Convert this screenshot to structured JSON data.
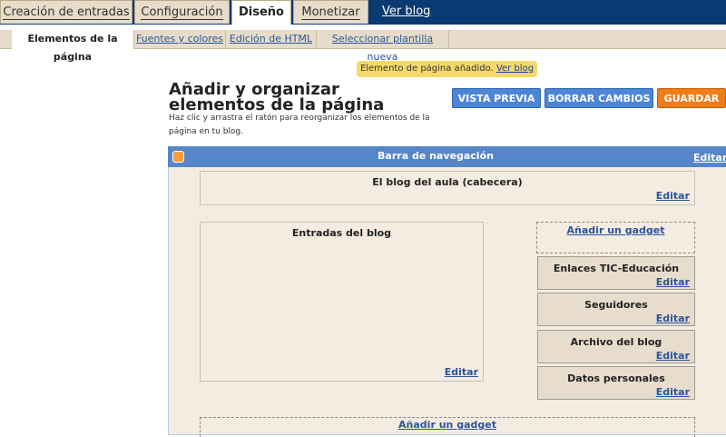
{
  "tabs": [
    {
      "label": "Creación de entradas"
    },
    {
      "label": "Configuración"
    },
    {
      "label": "Diseño"
    },
    {
      "label": "Monetizar"
    }
  ],
  "view_blog_link": "Ver blog",
  "subtabs": [
    {
      "label": "Elementos de la página"
    },
    {
      "label": "Fuentes y colores"
    },
    {
      "label": "Edición de HTML"
    },
    {
      "label": "Seleccionar plantilla nueva"
    }
  ],
  "notice": {
    "text": "Elemento de página añadido.",
    "link": "Ver blog"
  },
  "heading": {
    "title": "Añadir y organizar elementos de la página",
    "description": "Haz clic y arrastra el ratón para reorganizar los elementos de la página en tu blog."
  },
  "buttons": {
    "preview": "VISTA PREVIA",
    "clear": "BORRAR CAMBIOS",
    "save": "GUARDAR"
  },
  "layout": {
    "navbar": {
      "title": "Barra de navegación",
      "edit": "Editar"
    },
    "header": {
      "title": "El blog del aula (cabecera)",
      "edit": "Editar"
    },
    "posts": {
      "title": "Entradas del blog",
      "edit": "Editar"
    },
    "sidebar_add": "Añadir un gadget",
    "gadgets": [
      {
        "title": "Enlaces TIC-Educación",
        "edit": "Editar"
      },
      {
        "title": "Seguidores",
        "edit": "Editar"
      },
      {
        "title": "Archivo del blog",
        "edit": "Editar"
      },
      {
        "title": "Datos personales",
        "edit": "Editar"
      }
    ],
    "footer_add": "Añadir un gadget"
  },
  "colors": {
    "topbar": "#0b3a73",
    "navbar": "#5686c7",
    "accent_orange": "#f07d1a",
    "button_blue": "#4d86d6"
  }
}
